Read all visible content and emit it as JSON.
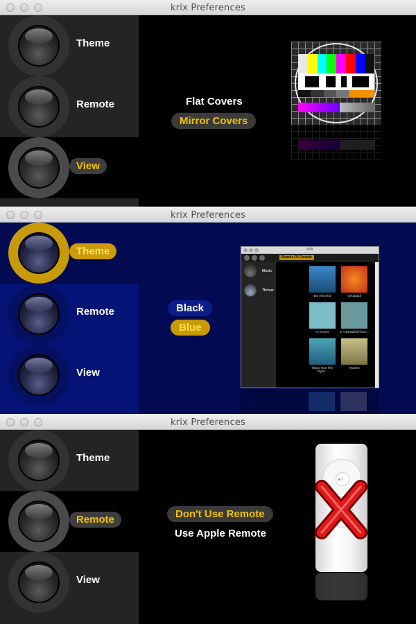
{
  "windows": [
    {
      "title": "krix Preferences",
      "sidebar": [
        {
          "label": "Theme",
          "selected": false
        },
        {
          "label": "Remote",
          "selected": false
        },
        {
          "label": "View",
          "selected": true
        }
      ],
      "options": [
        {
          "label": "Flat Covers",
          "selected": false
        },
        {
          "label": "Mirror Covers",
          "selected": true
        }
      ]
    },
    {
      "title": "krix Preferences",
      "sidebar": [
        {
          "label": "Theme",
          "selected": true
        },
        {
          "label": "Remote",
          "selected": false
        },
        {
          "label": "View",
          "selected": false
        }
      ],
      "options": [
        {
          "label": "Black",
          "selected": false
        },
        {
          "label": "Blue",
          "selected": true
        }
      ],
      "preview": {
        "window_title": "krix",
        "breadcrumb": "Boards Of Canada",
        "sidebar_items": [
          "Music",
          "Thriver"
        ],
        "albums": [
          "Bon Moreira",
          "Geogaddi",
          "Hi Scores",
          "In A Beautiful Place...",
          "Music Has The Right...",
          "Twoism"
        ]
      }
    },
    {
      "title": "krix Preferences",
      "sidebar": [
        {
          "label": "Theme",
          "selected": false
        },
        {
          "label": "Remote",
          "selected": true
        },
        {
          "label": "View",
          "selected": false
        }
      ],
      "options": [
        {
          "label": "Don't Use Remote",
          "selected": true
        },
        {
          "label": "Use Apple Remote",
          "selected": false
        }
      ],
      "remote_labels": {
        "play": "▶ll",
        "menu": "MENU"
      }
    }
  ],
  "icons": {
    "sidebar_button": "glass-orb-icon",
    "view_preview": "test-card-icon",
    "theme_preview": "app-screenshot-icon",
    "remote_preview": "apple-remote-icon",
    "disabled_mark": "red-x-icon"
  },
  "colors": {
    "selected_text": "#f3c100",
    "dark_bg": "#000000",
    "dark_sidebar": "#242424",
    "blue_bg": "#020a52",
    "blue_sidebar": "#051276",
    "blue_ring": "#c79a09"
  }
}
